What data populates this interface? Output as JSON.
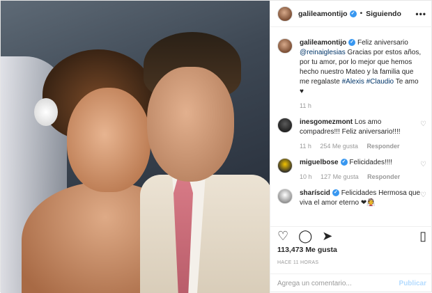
{
  "header": {
    "username": "galileamontijo",
    "follow_status": "Siguiendo",
    "more": "•••"
  },
  "caption": {
    "username": "galileamontijo",
    "text_before_mention": "Feliz aniversario ",
    "mention": "@reinaiglesias",
    "text_middle": " Gracias por estos años, por tu amor, por lo mejor que hemos hecho nuestro Mateo y la familia que me regalaste ",
    "hashtag1": "#Alexis",
    "hashtag2": "#Claudio",
    "text_end": " Te amo ",
    "emoji": "♥",
    "time": "11 h"
  },
  "comments": [
    {
      "username": "inesgomezmont",
      "text": "Los amo compadres!!! Feliz aniversario!!!!",
      "time": "11 h",
      "likes": "254 Me gusta",
      "reply": "Responder"
    },
    {
      "username": "miguelbose",
      "text": "Felicidades!!!!",
      "time": "10 h",
      "likes": "127 Me gusta",
      "reply": "Responder"
    },
    {
      "username": "sharíscid",
      "text": "Felicidades Hermosa que viva el amor eterno ❤👰",
      "time": "",
      "likes": "",
      "reply": ""
    }
  ],
  "actions": {
    "like_icon": "♡",
    "comment_icon": "◯",
    "share_icon": "➤",
    "save_icon": "▯"
  },
  "likes_count": "113,473",
  "likes_label": "Me gusta",
  "timestamp": "HACE 11 HORAS",
  "composer": {
    "placeholder": "Agrega un comentario...",
    "post_label": "Publicar"
  }
}
